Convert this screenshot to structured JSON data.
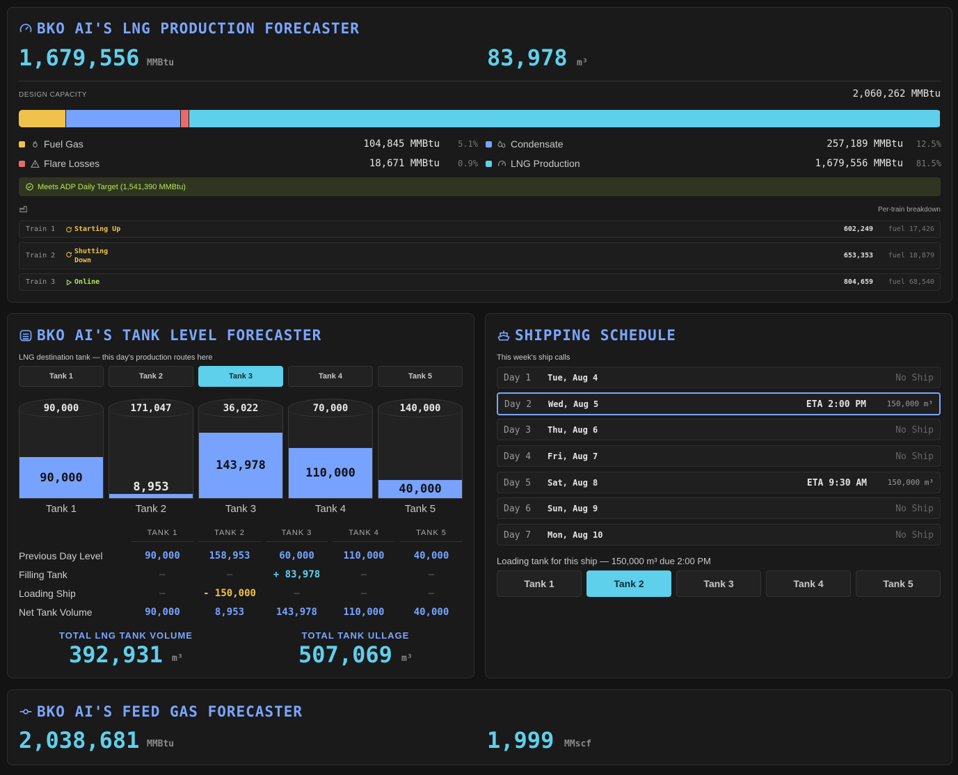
{
  "production": {
    "title": "BKO AI'S LNG PRODUCTION FORECASTER",
    "total_mmbtu": "1,679,556",
    "total_mmbtu_unit": "MMBtu",
    "total_m3": "83,978",
    "total_m3_unit": "m³",
    "design_capacity_label": "DESIGN CAPACITY",
    "design_capacity_value": "2,060,262 MMBtu",
    "capacity_segments": [
      {
        "name": "Fuel Gas",
        "fraction": 0.051,
        "color": "#f0c24b"
      },
      {
        "name": "Condensate",
        "fraction": 0.125,
        "color": "#77a3ff"
      },
      {
        "name": "Flare Losses",
        "fraction": 0.009,
        "color": "#e86b6b"
      },
      {
        "name": "LNG Production",
        "fraction": 0.815,
        "color": "#5fd0ec"
      }
    ],
    "legend": [
      {
        "name": "Fuel Gas",
        "value": "104,845 MMBtu",
        "pct": "5.1%",
        "color": "#f0c24b",
        "icon": "flame-icon"
      },
      {
        "name": "Condensate",
        "value": "257,189 MMBtu",
        "pct": "12.5%",
        "color": "#77a3ff",
        "icon": "droplets-icon"
      },
      {
        "name": "Flare Losses",
        "value": "18,671 MMBtu",
        "pct": "0.9%",
        "color": "#e86b6b",
        "icon": "warning-icon"
      },
      {
        "name": "LNG Production",
        "value": "1,679,556 MMBtu",
        "pct": "81.5%",
        "color": "#5fd0ec",
        "icon": "gauge-icon"
      }
    ],
    "target_message": "Meets ADP Daily Target (1,541,390 MMBtu)",
    "per_train_label": "Per-train breakdown",
    "trains": [
      {
        "name": "Train 1",
        "status": "Starting Up",
        "status_color": "#f0c24b",
        "value": "602,249",
        "fuel": "fuel 17,426"
      },
      {
        "name": "Train 2",
        "status": "Shutting Down",
        "status_color": "#f0c24b",
        "value": "653,353",
        "fuel": "fuel 18,879"
      },
      {
        "name": "Train 3",
        "status": "Online",
        "status_color": "#b3e65b",
        "value": "804,659",
        "fuel": "fuel 68,540"
      }
    ]
  },
  "tanks": {
    "title": "BKO AI'S TANK LEVEL FORECASTER",
    "subtitle": "LNG destination tank — this day's production routes here",
    "tabs": [
      "Tank 1",
      "Tank 2",
      "Tank 3",
      "Tank 4",
      "Tank 5"
    ],
    "active_tab": 2,
    "items": [
      {
        "name": "Tank 1",
        "ullage": "90,000",
        "level": "90,000",
        "fill": 0.5
      },
      {
        "name": "Tank 2",
        "ullage": "171,047",
        "level": "8,953",
        "fill": 0.05
      },
      {
        "name": "Tank 3",
        "ullage": "36,022",
        "level": "143,978",
        "fill": 0.8
      },
      {
        "name": "Tank 4",
        "ullage": "70,000",
        "level": "110,000",
        "fill": 0.611
      },
      {
        "name": "Tank 5",
        "ullage": "140,000",
        "level": "40,000",
        "fill": 0.222
      }
    ],
    "table": {
      "headers": [
        "TANK 1",
        "TANK 2",
        "TANK 3",
        "TANK 4",
        "TANK 5"
      ],
      "rows": [
        {
          "label": "Previous Day Level",
          "cells": [
            "90,000",
            "158,953",
            "60,000",
            "110,000",
            "40,000"
          ]
        },
        {
          "label": "Filling Tank",
          "cells": [
            "—",
            "—",
            "+ 83,978",
            "—",
            "—"
          ]
        },
        {
          "label": "Loading Ship",
          "cells": [
            "—",
            "- 150,000",
            "—",
            "—",
            "—"
          ]
        },
        {
          "label": "Net Tank Volume",
          "cells": [
            "90,000",
            "8,953",
            "143,978",
            "110,000",
            "40,000"
          ]
        }
      ]
    },
    "total_volume_label": "TOTAL LNG TANK VOLUME",
    "total_volume": "392,931",
    "total_ullage_label": "TOTAL TANK ULLAGE",
    "total_ullage": "507,069",
    "unit": "m³"
  },
  "shipping": {
    "title": "SHIPPING SCHEDULE",
    "subtitle": "This week's ship calls",
    "days": [
      {
        "day": "Day 1",
        "date": "Tue, Aug 4",
        "no_ship": "No Ship"
      },
      {
        "day": "Day 2",
        "date": "Wed, Aug 5",
        "eta": "ETA 2:00 PM",
        "volume": "150,000 m³"
      },
      {
        "day": "Day 3",
        "date": "Thu, Aug 6",
        "no_ship": "No Ship"
      },
      {
        "day": "Day 4",
        "date": "Fri, Aug 7",
        "no_ship": "No Ship"
      },
      {
        "day": "Day 5",
        "date": "Sat, Aug 8",
        "eta": "ETA 9:30 AM",
        "volume": "150,000 m³"
      },
      {
        "day": "Day 6",
        "date": "Sun, Aug 9",
        "no_ship": "No Ship"
      },
      {
        "day": "Day 7",
        "date": "Mon, Aug 10",
        "no_ship": "No Ship"
      }
    ],
    "selected_day": 1,
    "loading_label": "Loading tank for this ship — 150,000 m³ due 2:00 PM",
    "tanks": [
      "Tank 1",
      "Tank 2",
      "Tank 3",
      "Tank 4",
      "Tank 5"
    ],
    "active_tank": 1
  },
  "feedgas": {
    "title": "BKO AI'S FEED GAS FORECASTER",
    "mmbtu": "2,038,681",
    "mmbtu_unit": "MMBtu",
    "mmscf": "1,999",
    "mmscf_unit": "MMscf"
  }
}
